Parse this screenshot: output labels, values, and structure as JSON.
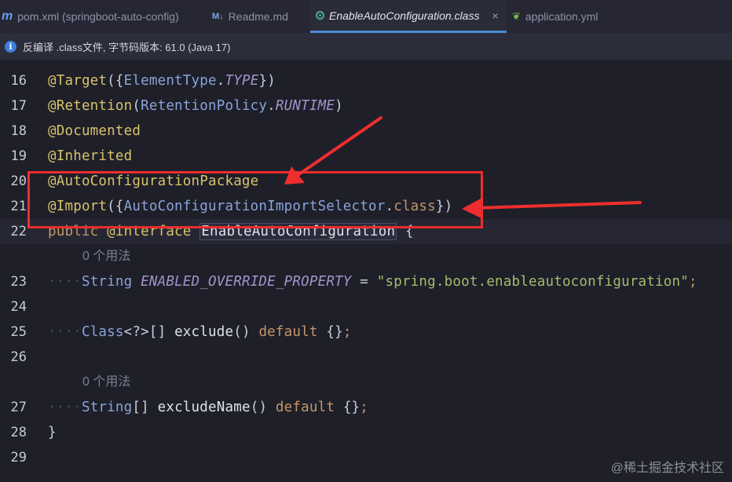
{
  "tabs": [
    {
      "icon": "m",
      "label": "pom.xml (springboot-auto-config)"
    },
    {
      "icon": "M↓",
      "label": "Readme.md"
    },
    {
      "label": "EnableAutoConfiguration.class",
      "close": "×"
    },
    {
      "label": "application.yml"
    }
  ],
  "banner": {
    "info_glyph": "i",
    "text": "反编译 .class文件, 字节码版本: 61.0 (Java 17)"
  },
  "lines": [
    {
      "num": "16",
      "code": "@Target({ElementType.TYPE})"
    },
    {
      "num": "17",
      "code": "@Retention(RetentionPolicy.RUNTIME)"
    },
    {
      "num": "18",
      "code": "@Documented"
    },
    {
      "num": "19",
      "code": "@Inherited"
    },
    {
      "num": "20",
      "code": "@AutoConfigurationPackage"
    },
    {
      "num": "21",
      "code": "@Import({AutoConfigurationImportSelector.class})"
    },
    {
      "num": "22",
      "code": "public @interface EnableAutoConfiguration {"
    },
    {
      "num": "23",
      "code": "String ENABLED_OVERRIDE_PROPERTY = \"spring.boot.enableautoconfiguration\";"
    },
    {
      "num": "24",
      "code": ""
    },
    {
      "num": "25",
      "code": "Class<?>[] exclude() default {};"
    },
    {
      "num": "26",
      "code": ""
    },
    {
      "num": "27",
      "code": "String[] excludeName() default {};"
    },
    {
      "num": "28",
      "code": "}"
    },
    {
      "num": "29",
      "code": ""
    }
  ],
  "usage_hints": [
    "0 个用法",
    "0 个用法"
  ],
  "tokens": {
    "l16": [
      "@Target",
      "({",
      "ElementType",
      ".",
      "TYPE",
      "})"
    ],
    "l17": [
      "@Retention",
      "(",
      "RetentionPolicy",
      ".",
      "RUNTIME",
      ")"
    ],
    "l18": [
      "@Documented"
    ],
    "l19": [
      "@Inherited"
    ],
    "l20": [
      "@AutoConfigurationPackage"
    ],
    "l21": [
      "@Import",
      "({",
      "AutoConfigurationImportSelector",
      ".",
      "class",
      "})"
    ],
    "l22": [
      "public",
      " ",
      "@interface",
      " ",
      "EnableAutoConfiguration",
      " {"
    ],
    "l23": [
      "····",
      "String",
      " ",
      "ENABLED_OVERRIDE_PROPERTY",
      " = ",
      "\"spring.boot.enableautoconfiguration\"",
      ";"
    ],
    "l25": [
      "····",
      "Class",
      "<?>[] ",
      "exclude",
      "() ",
      "default",
      " {}",
      ";"
    ],
    "l27": [
      "····",
      "String",
      "[] ",
      "excludeName",
      "() ",
      "default",
      " {}",
      ";"
    ],
    "l28": [
      "}"
    ]
  },
  "watermark": "@稀土掘金技术社区",
  "colors": {
    "annotation_box": "#ee2e2e",
    "arrow": "#ee2e2e",
    "accent": "#4d8bd6"
  }
}
